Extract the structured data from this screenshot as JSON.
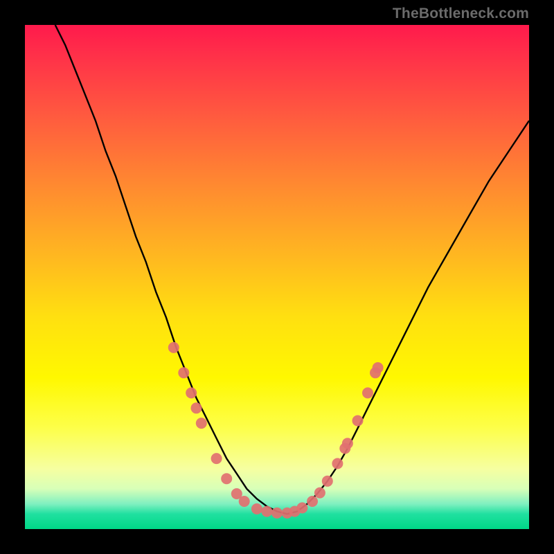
{
  "watermark": "TheBottleneck.com",
  "chart_data": {
    "type": "line",
    "title": "",
    "xlabel": "",
    "ylabel": "",
    "xlim": [
      0,
      100
    ],
    "ylim": [
      0,
      100
    ],
    "series": [
      {
        "name": "curve",
        "x": [
          6,
          8,
          10,
          12,
          14,
          16,
          18,
          20,
          22,
          24,
          26,
          28,
          30,
          32,
          34,
          36,
          38,
          40,
          42,
          44,
          46,
          48,
          50,
          52,
          54,
          56,
          58,
          60,
          62,
          64,
          66,
          68,
          70,
          72,
          76,
          80,
          84,
          88,
          92,
          96,
          100
        ],
        "y": [
          100,
          96,
          91,
          86,
          81,
          75,
          70,
          64,
          58,
          53,
          47,
          42,
          36,
          31,
          26,
          22,
          18,
          14,
          11,
          8,
          6,
          4.5,
          3.5,
          3,
          3.5,
          5,
          7,
          9.5,
          12.5,
          16,
          20,
          24,
          28,
          32,
          40,
          48,
          55,
          62,
          69,
          75,
          81
        ]
      }
    ],
    "points": [
      {
        "x": 29.5,
        "y": 36
      },
      {
        "x": 31.5,
        "y": 31
      },
      {
        "x": 33.0,
        "y": 27
      },
      {
        "x": 34.0,
        "y": 24
      },
      {
        "x": 35.0,
        "y": 21
      },
      {
        "x": 38.0,
        "y": 14
      },
      {
        "x": 40.0,
        "y": 10
      },
      {
        "x": 42.0,
        "y": 7
      },
      {
        "x": 43.5,
        "y": 5.5
      },
      {
        "x": 46.0,
        "y": 4
      },
      {
        "x": 48.0,
        "y": 3.5
      },
      {
        "x": 50.0,
        "y": 3.2
      },
      {
        "x": 52.0,
        "y": 3.2
      },
      {
        "x": 53.5,
        "y": 3.5
      },
      {
        "x": 55.0,
        "y": 4.2
      },
      {
        "x": 57.0,
        "y": 5.5
      },
      {
        "x": 58.5,
        "y": 7.2
      },
      {
        "x": 60.0,
        "y": 9.5
      },
      {
        "x": 62.0,
        "y": 13
      },
      {
        "x": 63.5,
        "y": 16
      },
      {
        "x": 64.0,
        "y": 17
      },
      {
        "x": 66.0,
        "y": 21.5
      },
      {
        "x": 68.0,
        "y": 27
      },
      {
        "x": 69.5,
        "y": 31
      },
      {
        "x": 70.0,
        "y": 32
      }
    ],
    "colors": {
      "curve": "#000000",
      "points": "#e17070",
      "gradient_top": "#ff1a4c",
      "gradient_mid": "#fff000",
      "gradient_bottom": "#00d887"
    }
  }
}
